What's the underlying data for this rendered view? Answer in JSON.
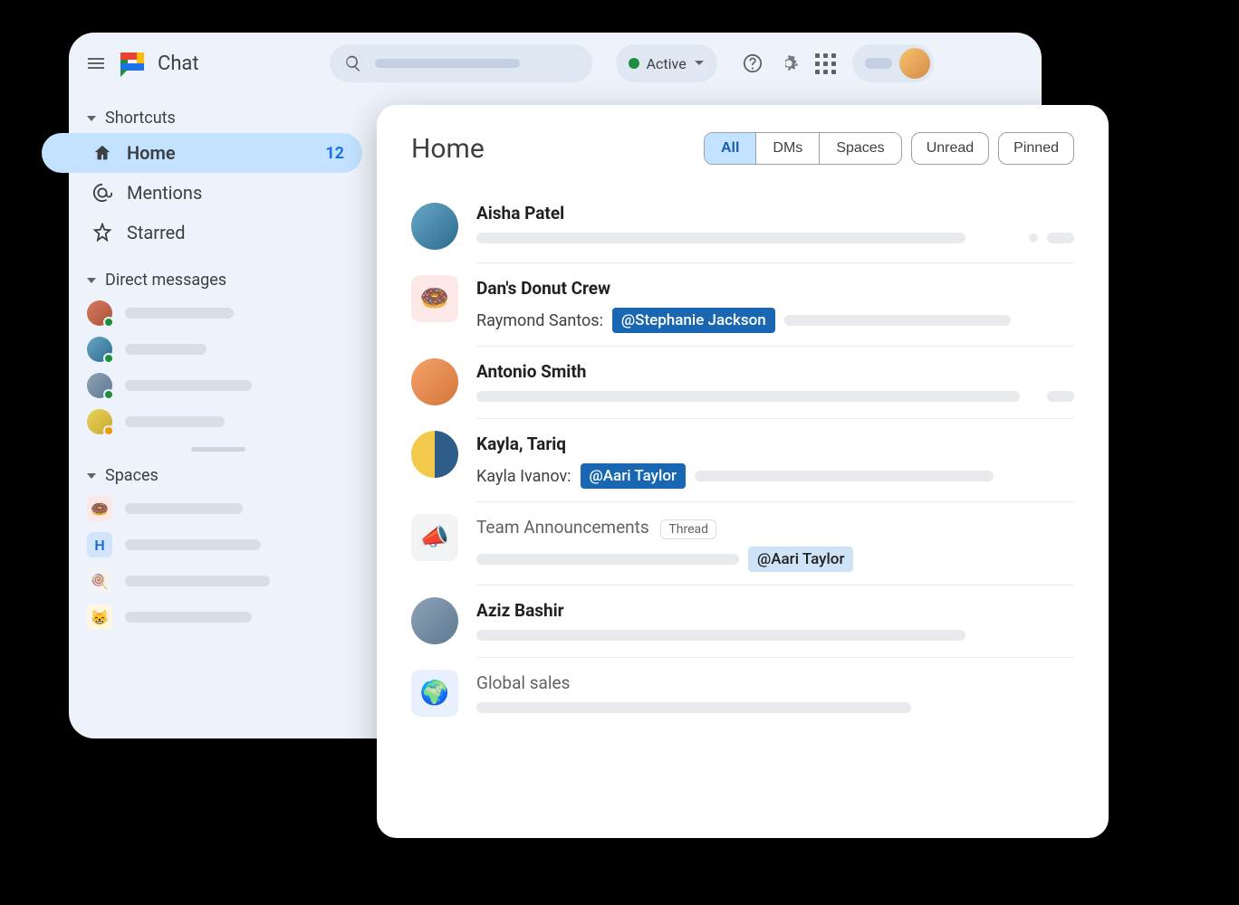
{
  "header": {
    "app_name": "Chat",
    "status_label": "Active"
  },
  "sidebar": {
    "sections": {
      "shortcuts": "Shortcuts",
      "dms": "Direct messages",
      "spaces": "Spaces"
    },
    "shortcuts": [
      {
        "key": "home",
        "label": "Home",
        "badge": "12",
        "active": true,
        "icon": "home-icon"
      },
      {
        "key": "mentions",
        "label": "Mentions",
        "icon": "at-icon"
      },
      {
        "key": "starred",
        "label": "Starred",
        "icon": "star-icon"
      }
    ]
  },
  "main": {
    "title": "Home",
    "filters": {
      "segmented": [
        "All",
        "DMs",
        "Spaces"
      ],
      "active_segment": "All",
      "pills": [
        "Unread",
        "Pinned"
      ]
    },
    "conversations": [
      {
        "type": "dm",
        "title": "Aisha Patel"
      },
      {
        "type": "space",
        "title": "Dan's Donut Crew",
        "sender": "Raymond Santos:",
        "mention": "@Stephanie Jackson",
        "mention_style": "strong",
        "icon": "donut"
      },
      {
        "type": "dm",
        "title": "Antonio Smith"
      },
      {
        "type": "group",
        "title": "Kayla, Tariq",
        "sender": "Kayla Ivanov:",
        "mention": "@Aari Taylor",
        "mention_style": "strong"
      },
      {
        "type": "space",
        "title": "Team Announcements",
        "thread": "Thread",
        "mention": "@Aari Taylor",
        "mention_style": "soft",
        "muted": true,
        "icon": "megaphone"
      },
      {
        "type": "dm",
        "title": "Aziz Bashir"
      },
      {
        "type": "space",
        "title": "Global sales",
        "muted": true,
        "icon": "globe"
      }
    ]
  }
}
